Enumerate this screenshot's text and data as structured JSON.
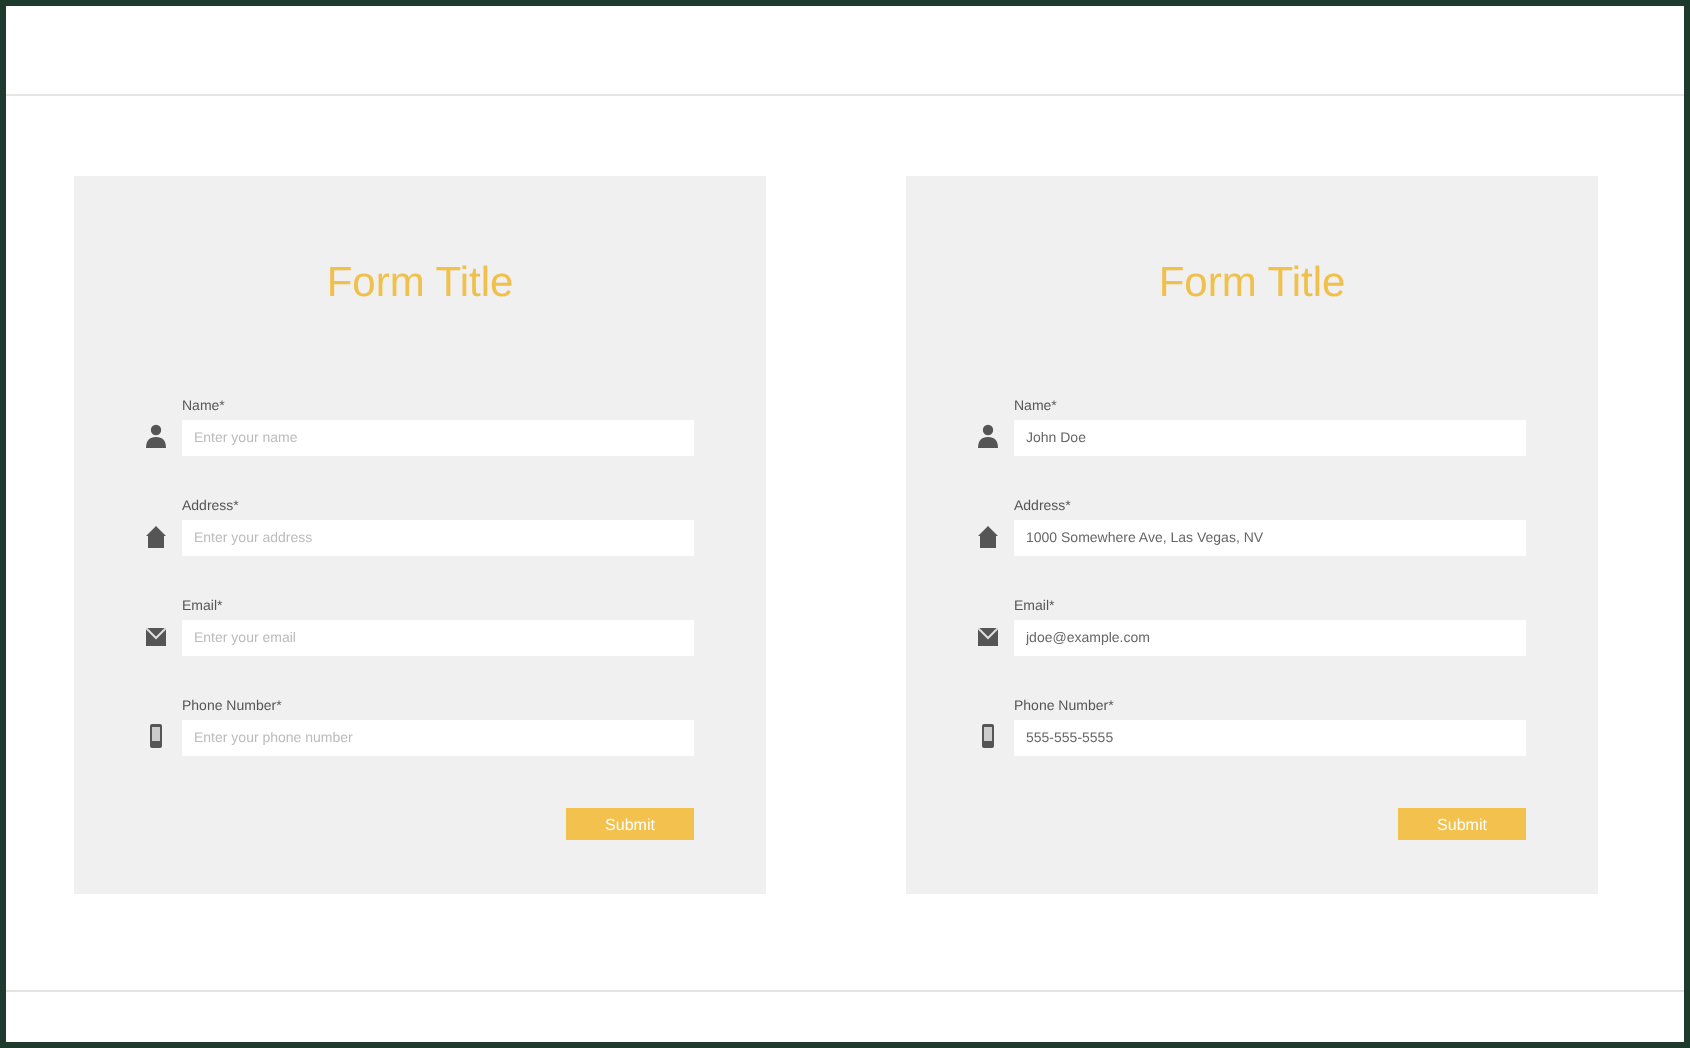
{
  "forms": [
    {
      "title": "Form Title",
      "fields": [
        {
          "kind": "name",
          "label": "Name*",
          "placeholder": "Enter your name"
        },
        {
          "kind": "address",
          "label": "Address*",
          "placeholder": "Enter your address"
        },
        {
          "kind": "email",
          "label": "Email*",
          "placeholder": "Enter your email"
        },
        {
          "kind": "phone",
          "label": "Phone Number*",
          "placeholder": "Enter your phone number"
        }
      ],
      "button": "Submit"
    },
    {
      "title": "Form Title",
      "fields": [
        {
          "kind": "name",
          "label": "Name*",
          "value": "John Doe"
        },
        {
          "kind": "address",
          "label": "Address*",
          "value": "1000 Somewhere Ave, Las Vegas, NV"
        },
        {
          "kind": "email",
          "label": "Email*",
          "value": "jdoe@example.com"
        },
        {
          "kind": "phone",
          "label": "Phone Number*",
          "value": "555-555-5555"
        }
      ],
      "button": "Submit"
    }
  ]
}
